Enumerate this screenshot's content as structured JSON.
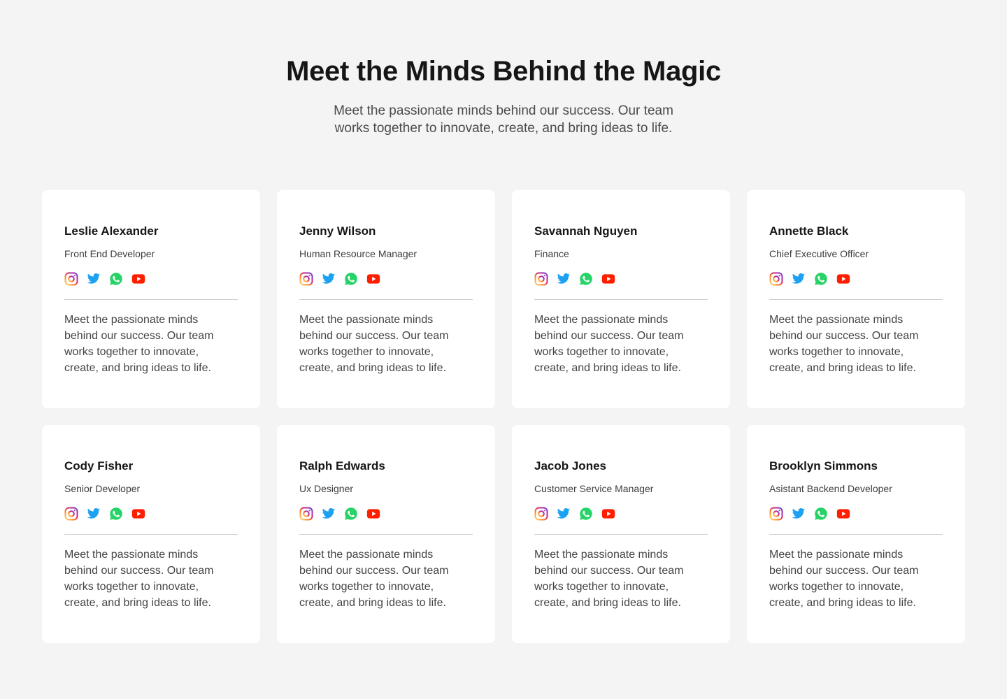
{
  "header": {
    "title": "Meet the Minds Behind the Magic",
    "subtitle": "Meet the passionate minds behind our success. Our team works together to innovate, create, and bring ideas to life."
  },
  "socials": [
    "instagram-icon",
    "twitter-icon",
    "whatsapp-icon",
    "youtube-icon"
  ],
  "colors": {
    "background": "#f4f4f4",
    "card": "#ffffff",
    "twitter": "#1da1f2",
    "whatsapp": "#25d366",
    "youtube": "#ff1e00"
  },
  "team": [
    {
      "name": "Leslie Alexander",
      "role": "Front End Developer",
      "bio": "Meet the passionate minds behind our success. Our team works together to innovate, create, and bring ideas to life."
    },
    {
      "name": "Jenny Wilson",
      "role": "Human Resource Manager",
      "bio": "Meet the passionate minds behind our success. Our team works together to innovate, create, and bring ideas to life."
    },
    {
      "name": "Savannah Nguyen",
      "role": "Finance",
      "bio": "Meet the passionate minds behind our success. Our team works together to innovate, create, and bring ideas to life."
    },
    {
      "name": "Annette Black",
      "role": "Chief Executive Officer",
      "bio": "Meet the passionate minds behind our success. Our team works together to innovate, create, and bring ideas to life."
    },
    {
      "name": "Cody Fisher",
      "role": "Senior Developer",
      "bio": "Meet the passionate minds behind our success. Our team works together to innovate, create, and bring ideas to life."
    },
    {
      "name": "Ralph Edwards",
      "role": "Ux Designer",
      "bio": "Meet the passionate minds behind our success. Our team works together to innovate, create, and bring ideas to life."
    },
    {
      "name": "Jacob Jones",
      "role": "Customer Service Manager",
      "bio": "Meet the passionate minds behind our success. Our team works together to innovate, create, and bring ideas to life."
    },
    {
      "name": "Brooklyn Simmons",
      "role": "Asistant Backend Developer",
      "bio": "Meet the passionate minds behind our success. Our team works together to innovate, create, and bring ideas to life."
    }
  ]
}
